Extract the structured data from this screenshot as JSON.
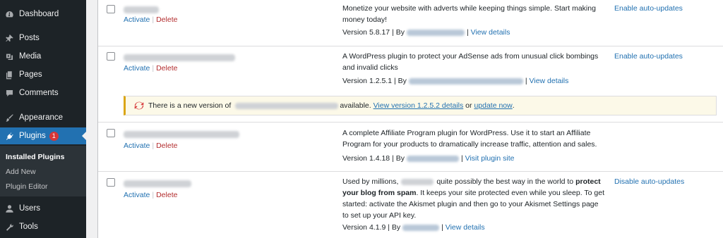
{
  "sidebar": {
    "items": [
      {
        "label": "Dashboard",
        "icon": "dashboard-icon"
      },
      {
        "label": "Posts",
        "icon": "pushpin-icon"
      },
      {
        "label": "Media",
        "icon": "media-icon"
      },
      {
        "label": "Pages",
        "icon": "pages-icon"
      },
      {
        "label": "Comments",
        "icon": "comment-icon"
      },
      {
        "label": "Appearance",
        "icon": "brush-icon"
      },
      {
        "label": "Plugins",
        "icon": "plug-icon",
        "badge": "1",
        "active": true
      },
      {
        "label": "Users",
        "icon": "user-icon"
      },
      {
        "label": "Tools",
        "icon": "wrench-icon"
      }
    ],
    "submenu": [
      "Installed Plugins",
      "Add New",
      "Plugin Editor"
    ]
  },
  "plugins": [
    {
      "activate": "Activate",
      "delete": "Delete",
      "description": "Monetize your website with adverts while keeping things simple. Start making money today!",
      "version": "Version 5.8.17",
      "by": "| By",
      "details": "View details",
      "auto_updates": "Enable auto-updates"
    },
    {
      "activate": "Activate",
      "delete": "Delete",
      "description": "A WordPress plugin to protect your AdSense ads from unusual click bombings and invalid clicks",
      "version": "Version 1.2.5.1",
      "by": "| By",
      "details": "View details",
      "auto_updates": "Enable auto-updates"
    },
    {
      "activate": "Activate",
      "delete": "Delete",
      "description": "A complete Affiliate Program plugin for WordPress. Use it to start an Affiliate Program for your products to dramatically increase traffic, attention and sales.",
      "version": "Version 1.4.18",
      "by": "| By",
      "details": "Visit plugin site"
    },
    {
      "activate": "Activate",
      "delete": "Delete",
      "description_prefix": "Used by millions,",
      "description_mid": "quite possibly the best way in the world to",
      "description_bold": "protect your blog from spam",
      "description_rest": ". It keeps your site protected even while you sleep. To get started: activate the Akismet plugin and then go to your Akismet Settings page to set up your API key.",
      "version": "Version 4.1.9",
      "by": "| By",
      "details": "View details",
      "auto_updates": "Disable auto-updates"
    }
  ],
  "update_notice": {
    "prefix": "There is a new version of",
    "available": "available.",
    "view_link": "View version 1.2.5.2 details",
    "or": "or",
    "update_link": "update now",
    "period": "."
  },
  "separator": "|",
  "colors": {
    "sidebar_bg": "#1d2327",
    "accent": "#2271b1",
    "delete": "#b32d2e",
    "badge": "#d63638",
    "notice_border": "#dba617"
  }
}
